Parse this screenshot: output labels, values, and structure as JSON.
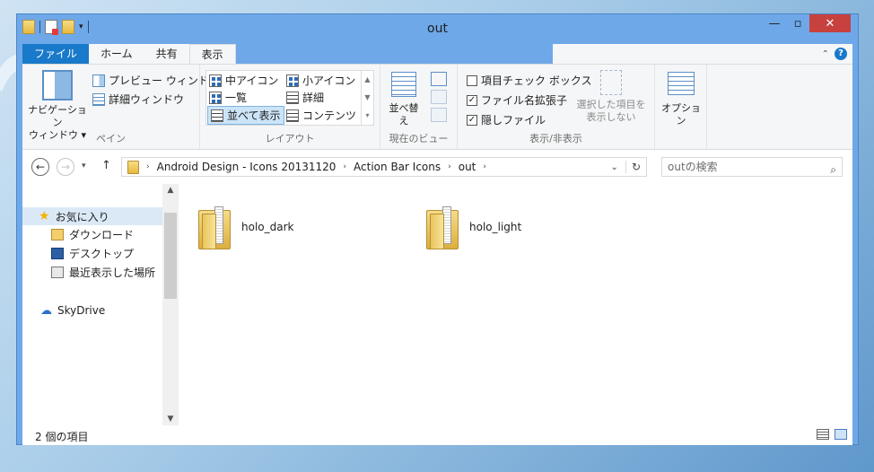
{
  "window": {
    "title": "out"
  },
  "tabs": {
    "file": "ファイル",
    "home": "ホーム",
    "share": "共有",
    "view": "表示"
  },
  "ribbon": {
    "pane_group": {
      "nav_pane_line1": "ナビゲーション",
      "nav_pane_line2": "ウィンドウ ▾",
      "preview": "プレビュー ウィンドウ",
      "details": "詳細ウィンドウ",
      "label": "ペイン"
    },
    "layout_group": {
      "items": [
        "中アイコン",
        "小アイコン",
        "一覧",
        "詳細",
        "並べて表示",
        "コンテンツ"
      ],
      "label": "レイアウト"
    },
    "current_view_group": {
      "sort": "並べ替え",
      "label": "現在のビュー"
    },
    "show_hide_group": {
      "item_checkboxes": "項目チェック ボックス",
      "file_extensions": "ファイル名拡張子",
      "hidden_files": "隠しファイル",
      "hide_selected_line1": "選択した項目を",
      "hide_selected_line2": "表示しない",
      "label": "表示/非表示"
    },
    "options": {
      "label": "オプション"
    }
  },
  "address": {
    "crumbs": [
      "Android Design - Icons 20131120",
      "Action Bar Icons",
      "out"
    ],
    "search_placeholder": "outの検索"
  },
  "nav": {
    "favorites": "お気に入り",
    "downloads": "ダウンロード",
    "desktop": "デスクトップ",
    "recent": "最近表示した場所",
    "skydrive": "SkyDrive"
  },
  "files": [
    {
      "name": "holo_dark"
    },
    {
      "name": "holo_light"
    }
  ],
  "status": {
    "count": "2 個の項目"
  },
  "colors": {
    "accent": "#1979ca",
    "titlebar": "#6ea8e8",
    "close": "#c7413f"
  }
}
